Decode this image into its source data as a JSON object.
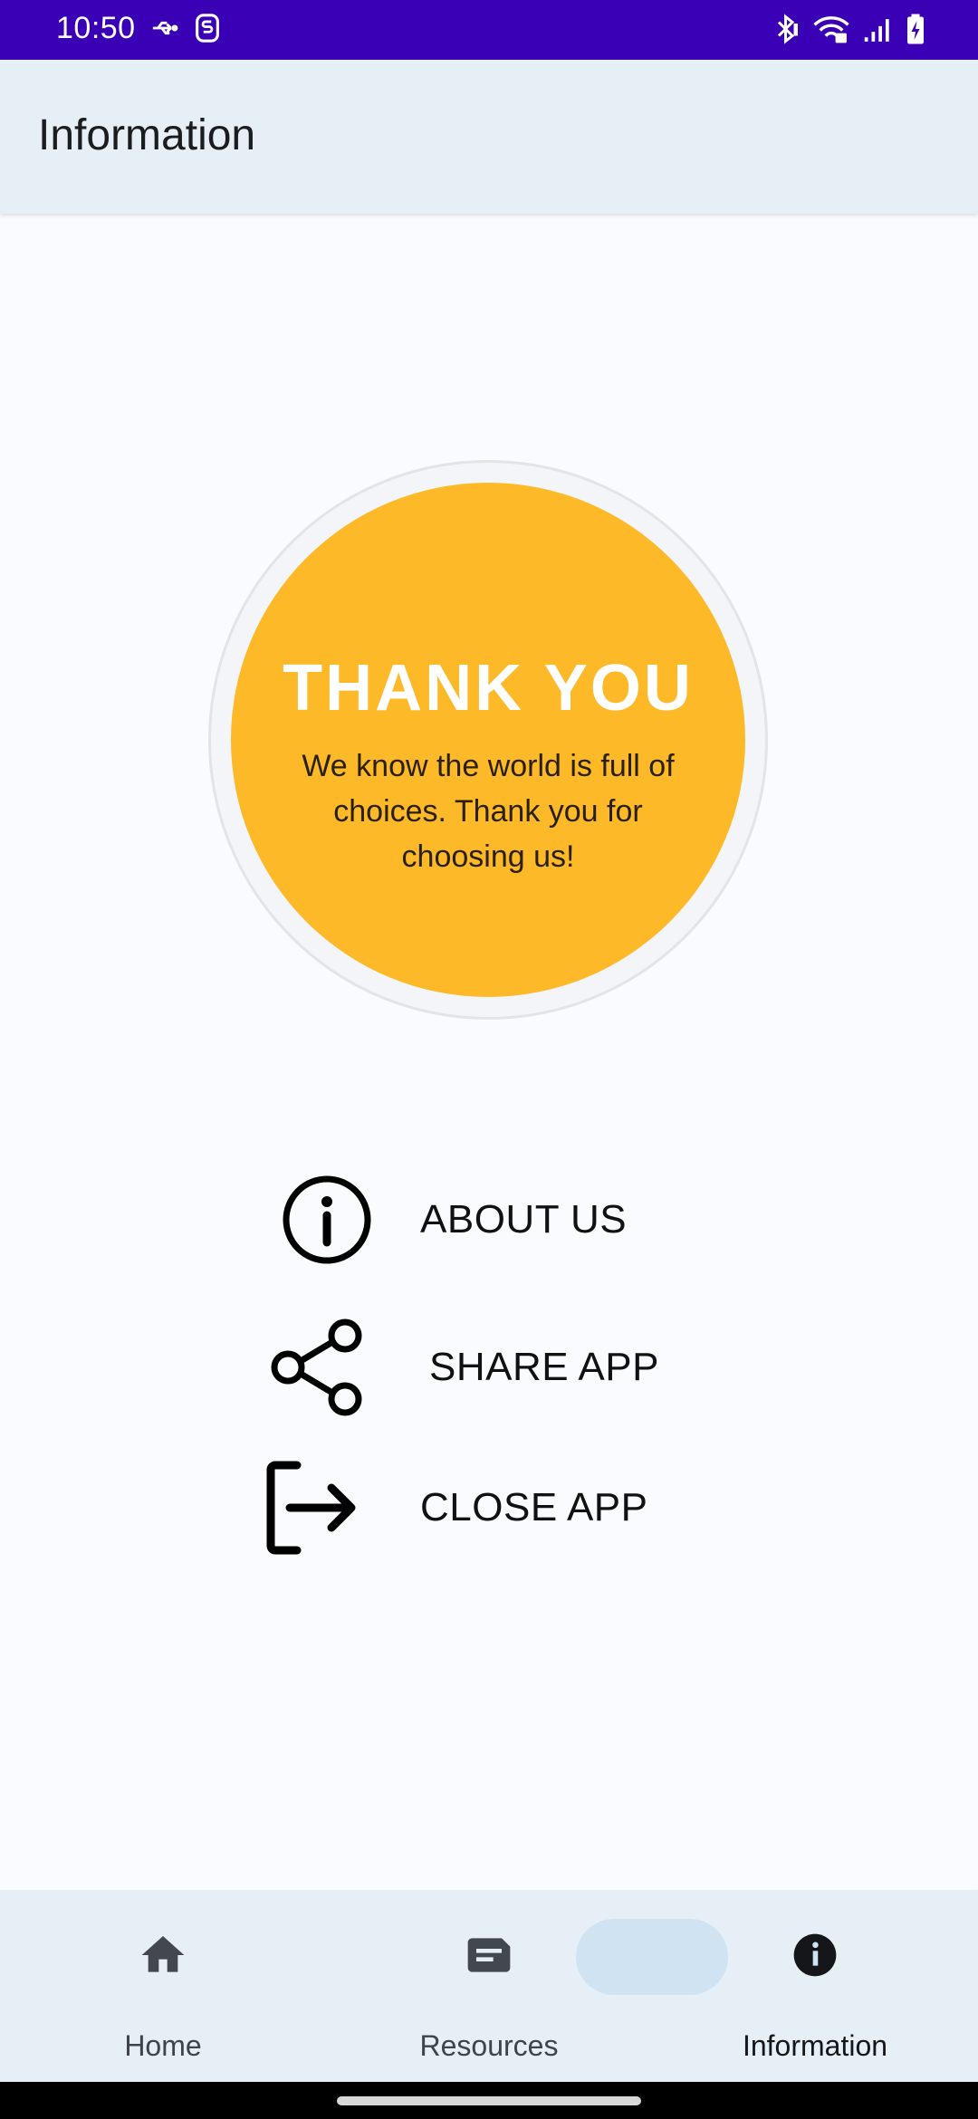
{
  "status_bar": {
    "time": "10:50",
    "left_icons": [
      "usb-icon",
      "sim-icon"
    ],
    "right_icons": [
      "bluetooth-icon",
      "wifi-icon",
      "signal-icon",
      "battery-icon"
    ],
    "background": "#3a00b5"
  },
  "app_bar": {
    "title": "Information"
  },
  "badge": {
    "title": "THANK YOU",
    "message": "We know the world is full of choices. Thank you for choosing us!",
    "color": "#fdb927"
  },
  "menu": {
    "items": [
      {
        "label": "ABOUT US",
        "icon": "info-icon"
      },
      {
        "label": "SHARE APP",
        "icon": "share-icon"
      },
      {
        "label": "CLOSE APP",
        "icon": "exit-icon"
      }
    ]
  },
  "bottom_nav": {
    "items": [
      {
        "label": "Home",
        "icon": "home-icon"
      },
      {
        "label": "Resources",
        "icon": "article-icon"
      },
      {
        "label": "Information",
        "icon": "info-filled-icon"
      }
    ],
    "active_index": 2,
    "active_pill_color": "#cfe3f3"
  }
}
